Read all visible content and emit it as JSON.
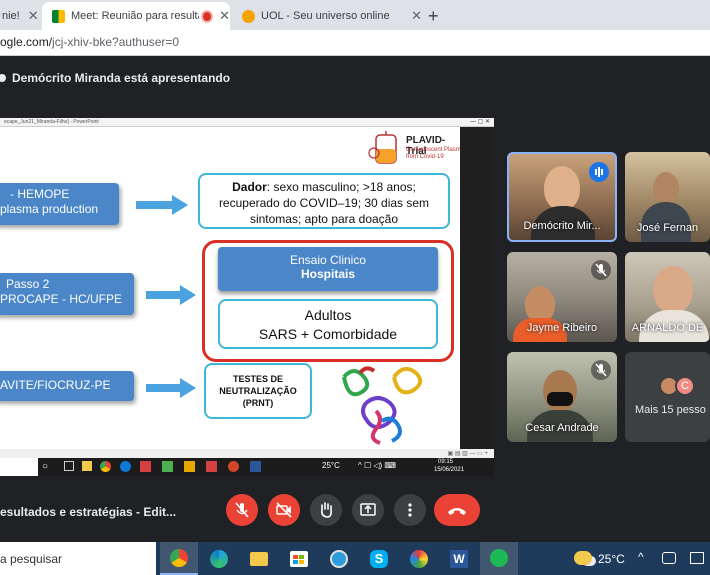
{
  "browser": {
    "tabs": [
      {
        "label": "nie!",
        "active": false
      },
      {
        "label": "Meet: Reunião para resultad",
        "active": true
      },
      {
        "label": "UOL - Seu universo online",
        "active": false
      }
    ],
    "new_tab_label": "+",
    "url_prefix": "ogle.com/",
    "url_path": "jcj-xhiv-bke?authuser=0"
  },
  "meet": {
    "presenter_text": "Demócrito Miranda está apresentando",
    "meeting_title": "esultados e estratégias - Edit...",
    "participants": [
      {
        "name": "Demócrito Mir...",
        "speaking": true
      },
      {
        "name": "José Fernan",
        "muted": false
      },
      {
        "name": "Jayme Ribeiro",
        "muted": true
      },
      {
        "name": "ARNALDO DE",
        "muted": false
      },
      {
        "name": "Cesar Andrade",
        "muted": true
      }
    ],
    "more_people": "Mais 15 pesso",
    "more_avatar_letter": "C"
  },
  "slide": {
    "window_title": "ecape_Jun21_Miranda-Filho] - PowerPoint",
    "logo_title": "PLAVID-Trial",
    "logo_subtitle": "Convalescent Plasma",
    "logo_subtitle2": "from Covid-19",
    "left_box1_line1": "- HEMOPE",
    "left_box1_line2": "plasma production",
    "left_box2_line1": "Passo 2",
    "left_box2_line2": "PROCAPE - HC/UFPE",
    "left_box3": "AVITE/FIOCRUZ-PE",
    "donor_label": "Dador",
    "donor_text": ": sexo masculino; >18 anos; recuperado do COVID–19; 30 dias sem sintomas; apto para doação",
    "ensaio_line1": "Ensaio Clinico",
    "ensaio_line2": "Hospitais",
    "adultos_line1": "Adultos",
    "adultos_line2": "SARS + Comorbidade",
    "testes_line1": "TESTES DE",
    "testes_line2": "NEUTRALIZAÇÃO",
    "testes_line3": "(PRNT)",
    "inner_temp": "25°C",
    "inner_time": "09:15",
    "inner_date": "15/06/2021"
  },
  "taskbar": {
    "search_placeholder": "a pesquisar",
    "temperature": "25°C"
  },
  "colors": {
    "accent_blue": "#4a86c8",
    "red_outline": "#d93025",
    "cyan_outline": "#3fb7d8",
    "end_call": "#ea4335"
  }
}
